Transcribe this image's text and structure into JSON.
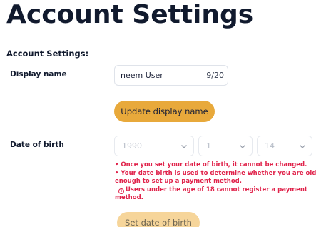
{
  "page": {
    "title": "Account Settings",
    "section_heading": "Account Settings:"
  },
  "display_name": {
    "label": "Display name",
    "value": "neem User",
    "counter": "9/20",
    "button_label": "Update display name"
  },
  "date_of_birth": {
    "label": "Date of birth",
    "year": "1990",
    "month": "1",
    "day": "14",
    "notes": [
      "• Once you set your date of birth, it cannot be changed.",
      "• Your date birth is used to determine whether you are old",
      "enough to set up a payment method.",
      "Users under the age of 18 cannot register a payment",
      "method."
    ],
    "button_label": "Set date of birth"
  },
  "colors": {
    "primary_button": "#e8a93b",
    "disabled_button": "#f6d59a",
    "warning_text": "#e0224a",
    "heading": "#111a2e"
  },
  "icons": {
    "select_chevron": "chevron-down-icon",
    "notice": "info-icon"
  }
}
